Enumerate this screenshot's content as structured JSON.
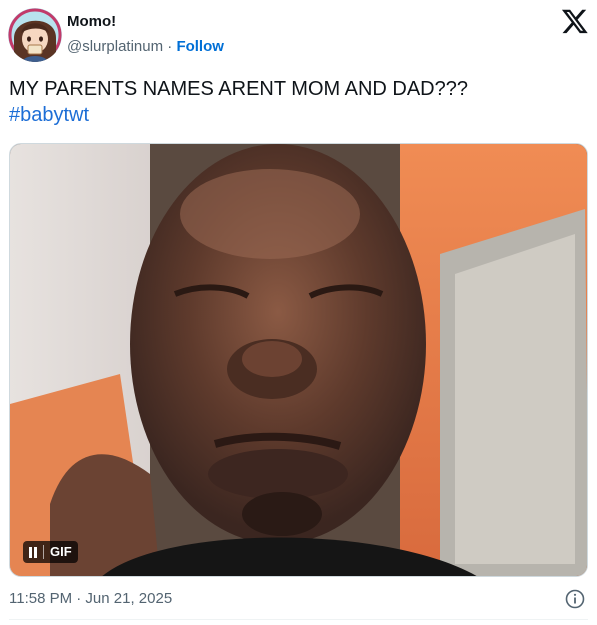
{
  "author": {
    "display_name": "Momo!",
    "handle": "@slurplatinum",
    "separator": " · ",
    "follow_label": "Follow",
    "avatar_icon": "anime-avatar"
  },
  "logo_icon": "x-logo-icon",
  "tweet": {
    "text": "MY PARENTS NAMES ARENT MOM AND DAD???",
    "hashtag": "#babytwt"
  },
  "media": {
    "type": "gif",
    "badge_label": "GIF",
    "description_icon": "man-looking-down-gif"
  },
  "footer": {
    "timestamp": "11:58 PM · Jun 21, 2025",
    "info_icon": "info-icon"
  },
  "colors": {
    "link": "#006fd6",
    "secondary_text": "#536471",
    "primary_text": "#0f1419"
  }
}
